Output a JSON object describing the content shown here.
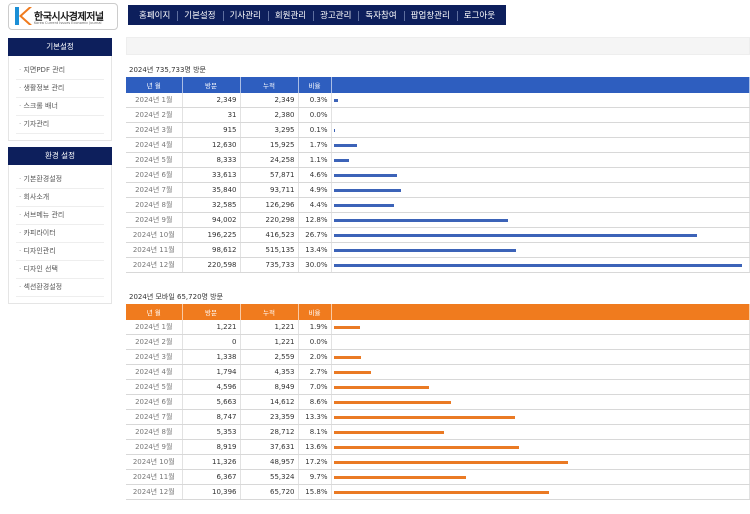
{
  "header": {
    "logo_title": "한국시사경제저널",
    "logo_sub": "Korea Current Issues Economic Journal",
    "nav": [
      "홈페이지",
      "기본설정",
      "기사관리",
      "회원관리",
      "광고관리",
      "독자참여",
      "팝업창관리",
      "로그아웃"
    ]
  },
  "sidebar": {
    "sections": [
      {
        "title": "기본설정",
        "items": [
          "지면PDF 관리",
          "생활정보 관리",
          "스크롤 배너",
          "기자관리"
        ]
      },
      {
        "title": "환경 설정",
        "items": [
          "기본환경설정",
          "회사소개",
          "서브메뉴 관리",
          "카피라이터",
          "디자인관리",
          "디자인 선택",
          "섹션환경설정"
        ]
      }
    ]
  },
  "colors": {
    "navy": "#0d1f5c",
    "blue_header": "#2e5ebf",
    "blue_bar": "#3c63b8",
    "orange_header": "#f07b1e",
    "orange_bar": "#ea7a24"
  },
  "tables": [
    {
      "title": "2024년 735,733명 방문",
      "headers": [
        "년 월",
        "방문",
        "누적",
        "비율",
        ""
      ],
      "rows": [
        {
          "month": "2024년 1월",
          "visits": "2,349",
          "total": "2,349",
          "ratio": "0.3%",
          "pct": 0.3
        },
        {
          "month": "2024년 2월",
          "visits": "31",
          "total": "2,380",
          "ratio": "0.0%",
          "pct": 0.0
        },
        {
          "month": "2024년 3월",
          "visits": "915",
          "total": "3,295",
          "ratio": "0.1%",
          "pct": 0.1
        },
        {
          "month": "2024년 4월",
          "visits": "12,630",
          "total": "15,925",
          "ratio": "1.7%",
          "pct": 1.7
        },
        {
          "month": "2024년 5월",
          "visits": "8,333",
          "total": "24,258",
          "ratio": "1.1%",
          "pct": 1.1
        },
        {
          "month": "2024년 6월",
          "visits": "33,613",
          "total": "57,871",
          "ratio": "4.6%",
          "pct": 4.6
        },
        {
          "month": "2024년 7월",
          "visits": "35,840",
          "total": "93,711",
          "ratio": "4.9%",
          "pct": 4.9
        },
        {
          "month": "2024년 8월",
          "visits": "32,585",
          "total": "126,296",
          "ratio": "4.4%",
          "pct": 4.4
        },
        {
          "month": "2024년 9월",
          "visits": "94,002",
          "total": "220,298",
          "ratio": "12.8%",
          "pct": 12.8
        },
        {
          "month": "2024년 10월",
          "visits": "196,225",
          "total": "416,523",
          "ratio": "26.7%",
          "pct": 26.7
        },
        {
          "month": "2024년 11월",
          "visits": "98,612",
          "total": "515,135",
          "ratio": "13.4%",
          "pct": 13.4
        },
        {
          "month": "2024년 12월",
          "visits": "220,598",
          "total": "735,733",
          "ratio": "30.0%",
          "pct": 30.0
        }
      ]
    },
    {
      "title": "2024년 모바일 65,720명 방문",
      "headers": [
        "년 월",
        "방문",
        "누적",
        "비율",
        ""
      ],
      "rows": [
        {
          "month": "2024년 1월",
          "visits": "1,221",
          "total": "1,221",
          "ratio": "1.9%",
          "pct": 1.9
        },
        {
          "month": "2024년 2월",
          "visits": "0",
          "total": "1,221",
          "ratio": "0.0%",
          "pct": 0.0
        },
        {
          "month": "2024년 3월",
          "visits": "1,338",
          "total": "2,559",
          "ratio": "2.0%",
          "pct": 2.0
        },
        {
          "month": "2024년 4월",
          "visits": "1,794",
          "total": "4,353",
          "ratio": "2.7%",
          "pct": 2.7
        },
        {
          "month": "2024년 5월",
          "visits": "4,596",
          "total": "8,949",
          "ratio": "7.0%",
          "pct": 7.0
        },
        {
          "month": "2024년 6월",
          "visits": "5,663",
          "total": "14,612",
          "ratio": "8.6%",
          "pct": 8.6
        },
        {
          "month": "2024년 7월",
          "visits": "8,747",
          "total": "23,359",
          "ratio": "13.3%",
          "pct": 13.3
        },
        {
          "month": "2024년 8월",
          "visits": "5,353",
          "total": "28,712",
          "ratio": "8.1%",
          "pct": 8.1
        },
        {
          "month": "2024년 9월",
          "visits": "8,919",
          "total": "37,631",
          "ratio": "13.6%",
          "pct": 13.6
        },
        {
          "month": "2024년 10월",
          "visits": "11,326",
          "total": "48,957",
          "ratio": "17.2%",
          "pct": 17.2
        },
        {
          "month": "2024년 11월",
          "visits": "6,367",
          "total": "55,324",
          "ratio": "9.7%",
          "pct": 9.7
        },
        {
          "month": "2024년 12월",
          "visits": "10,396",
          "total": "65,720",
          "ratio": "15.8%",
          "pct": 15.8
        }
      ]
    }
  ]
}
